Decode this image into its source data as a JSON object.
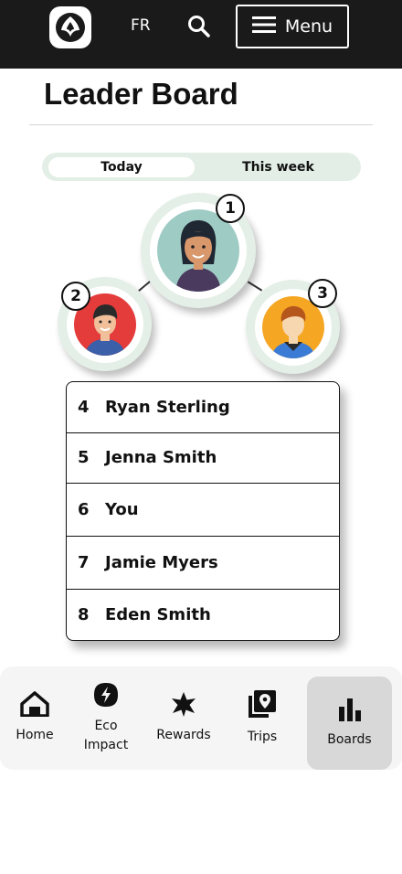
{
  "header": {
    "lang_label": "FR",
    "menu_label": "Menu"
  },
  "page": {
    "title": "Leader Board"
  },
  "tabs": {
    "today": "Today",
    "week": "This week",
    "selected": "Today"
  },
  "podium": {
    "first_rank": "1",
    "second_rank": "2",
    "third_rank": "3"
  },
  "leaderboard": [
    {
      "rank": "4",
      "name": "Ryan Sterling"
    },
    {
      "rank": "5",
      "name": "Jenna Smith"
    },
    {
      "rank": "6",
      "name": "You"
    },
    {
      "rank": "7",
      "name": "Jamie Myers"
    },
    {
      "rank": "8",
      "name": "Eden Smith"
    }
  ],
  "nav": {
    "home": "Home",
    "eco_line1": "Eco",
    "eco_line2": "Impact",
    "rewards": "Rewards",
    "trips": "Trips",
    "boards": "Boards",
    "active": "Boards"
  },
  "colors": {
    "topbar": "#1a1a1a",
    "tab_track": "#e3efe6",
    "podium_ring": "#e4efe7",
    "nav_bg": "#f5f5f5",
    "nav_active": "#d8d8d8",
    "avatar1_bg": "#9ecbc3",
    "avatar2_bg": "#e43b3b",
    "avatar3_bg": "#f5a623"
  },
  "icons": [
    "trillium-logo-icon",
    "search-icon",
    "hamburger-icon",
    "home-icon",
    "eco-bolt-icon",
    "rewards-star-icon",
    "trips-map-icon",
    "boards-bar-chart-icon"
  ]
}
